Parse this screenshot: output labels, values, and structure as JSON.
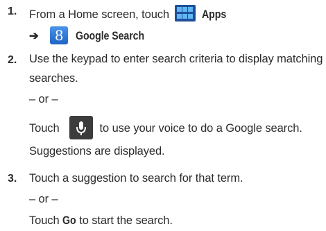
{
  "steps": [
    {
      "number": "1.",
      "line1_prefix": "From a Home screen, touch",
      "apps_label": "Apps",
      "arrow": "➔",
      "google_search_label": "Google Search",
      "line2_suffix": "."
    },
    {
      "number": "2.",
      "text_line1": "Use the keypad to enter search criteria to display matching",
      "text_line2": "searches.",
      "or": "– or –",
      "touch_prefix": "Touch",
      "touch_suffix": "to use your voice to do a Google search.",
      "result": "Suggestions are displayed."
    },
    {
      "number": "3.",
      "text_line1": "Touch a suggestion to search for that term.",
      "or": "– or –",
      "touch_prefix": "Touch",
      "go_label": "Go",
      "touch_suffix": "to start the search."
    }
  ],
  "icons": {
    "apps": "apps-grid-icon",
    "google_search": "google-search-icon",
    "microphone": "microphone-icon"
  },
  "colors": {
    "text": "#2b2b2b",
    "apps_icon": "#1f4f9a",
    "google_icon": "#2f78d6",
    "mic_icon_bg": "#3c3c3c"
  }
}
